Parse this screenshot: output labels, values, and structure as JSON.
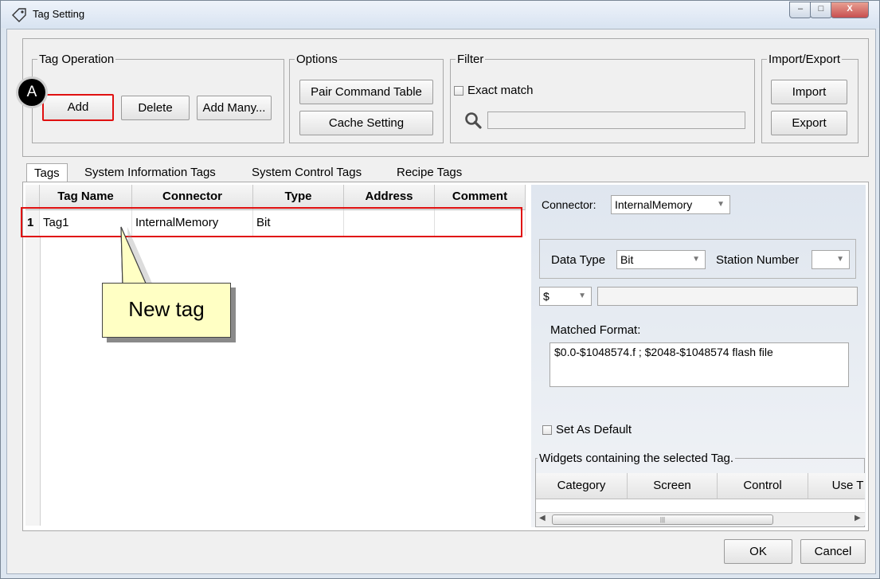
{
  "window": {
    "title": "Tag Setting",
    "controls": {
      "minimize": "–",
      "maximize": "□",
      "close": "X"
    }
  },
  "tag_operation": {
    "legend": "Tag Operation",
    "add": "Add",
    "delete": "Delete",
    "add_many": "Add Many..."
  },
  "options": {
    "legend": "Options",
    "pair_command_table": "Pair Command Table",
    "cache_setting": "Cache Setting"
  },
  "filter": {
    "legend": "Filter",
    "exact_match": "Exact match",
    "search_value": ""
  },
  "import_export": {
    "legend": "Import/Export",
    "import": "Import",
    "export": "Export"
  },
  "tabs": [
    "Tags",
    "System Information Tags",
    "System Control Tags",
    "Recipe Tags"
  ],
  "grid": {
    "columns": [
      "Tag Name",
      "Connector",
      "Type",
      "Address",
      "Comment"
    ],
    "rows": [
      {
        "index": "1",
        "tag_name": "Tag1",
        "connector": "InternalMemory",
        "type": "Bit",
        "address": "",
        "comment": ""
      }
    ]
  },
  "details": {
    "connector_label": "Connector:",
    "connector_value": "InternalMemory",
    "data_type_label": "Data Type",
    "data_type_value": "Bit",
    "station_number_label": "Station Number",
    "station_number_value": "",
    "prefix_value": "$",
    "address_value": "",
    "matched_format_label": "Matched Format:",
    "matched_format_value": "$0.0-$1048574.f ;  $2048-$1048574 flash file",
    "set_as_default": "Set As Default",
    "widgets_legend": "Widgets containing the selected Tag.",
    "widget_columns": [
      "Category",
      "Screen",
      "Control",
      "Use T"
    ],
    "scroll_thumb_glyph": "|||"
  },
  "footer": {
    "ok": "OK",
    "cancel": "Cancel"
  },
  "annotations": {
    "badge": "A",
    "callout": "New tag",
    "highlight_color": "#e01010"
  }
}
